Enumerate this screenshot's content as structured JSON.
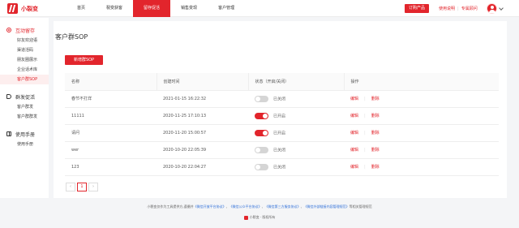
{
  "brand": {
    "name": "小裂变",
    "accent": "#e2252c"
  },
  "nav": {
    "items": [
      {
        "label": "首页",
        "active": false
      },
      {
        "label": "裂变获客",
        "active": false
      },
      {
        "label": "留存促活",
        "active": true
      },
      {
        "label": "销售变现",
        "active": false
      },
      {
        "label": "客户管理",
        "active": false
      }
    ],
    "order_button": "订购产品",
    "links": [
      "使用说明",
      "专属顾问"
    ]
  },
  "sidebar": {
    "groups": [
      {
        "label": "互动留存",
        "icon": "chat-icon",
        "active": true,
        "items": [
          {
            "label": "好友欢迎语",
            "active": false
          },
          {
            "label": "渠道活码",
            "active": false
          },
          {
            "label": "朋友圈展示",
            "active": false
          },
          {
            "label": "企业话术库",
            "active": false
          },
          {
            "label": "客户群SOP",
            "active": true
          }
        ]
      },
      {
        "label": "群发促活",
        "icon": "megaphone-icon",
        "active": false,
        "items": [
          {
            "label": "客户群发",
            "active": false
          },
          {
            "label": "客户群群发",
            "active": false
          }
        ]
      },
      {
        "label": "使用手册",
        "icon": "book-icon",
        "active": false,
        "items": [
          {
            "label": "使用手册",
            "active": false
          }
        ]
      }
    ]
  },
  "main": {
    "title": "客户群SOP",
    "new_button": "新增群SOP",
    "table": {
      "columns": [
        "名称",
        "创建时间",
        "状态（开启/关闭）",
        "操作"
      ],
      "rows": [
        {
          "name": "春节不打烊",
          "created": "2021-01-15 16:22:32",
          "on": false,
          "status": "已关闭"
        },
        {
          "name": "11111",
          "created": "2020-11-25 17:10:13",
          "on": true,
          "status": "已开启"
        },
        {
          "name": "请问",
          "created": "2020-11-20 15:00:57",
          "on": true,
          "status": "已开启"
        },
        {
          "name": "wer",
          "created": "2020-10-20 22:05:39",
          "on": false,
          "status": "已关闭"
        },
        {
          "name": "123",
          "created": "2020-10-20 22:04:27",
          "on": false,
          "status": "已关闭"
        }
      ],
      "actions": {
        "edit": "编辑",
        "delete": "删除"
      }
    },
    "pagination": {
      "prev": "‹",
      "current": "1",
      "next": "›"
    }
  },
  "footer": {
    "prefix": "小裂变仅作为工具提供方,遵循并",
    "links": [
      "《微信开放平台协议》",
      "《微信公众平台协议》",
      "《微信第三方服务协议》",
      "《微信外部链接内容管理规范》"
    ],
    "sep": "、",
    "suffix": "等相关管理规范",
    "brand_line": "小裂变 · 版权所有"
  }
}
